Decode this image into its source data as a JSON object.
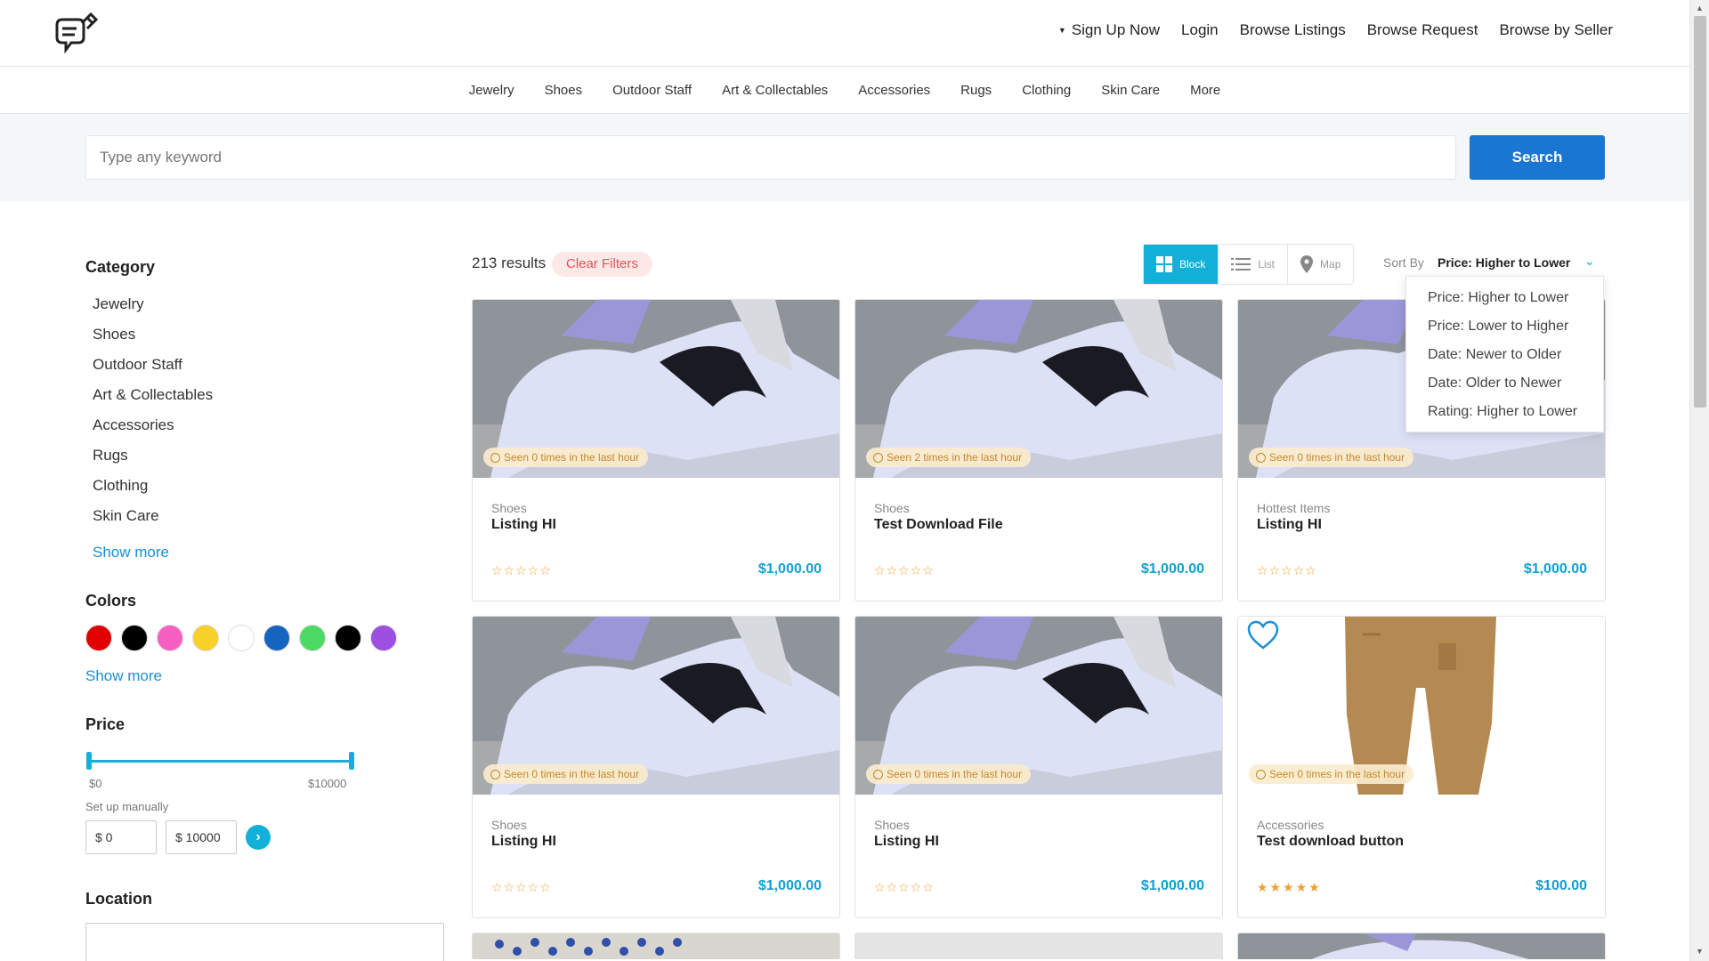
{
  "header": {
    "nav": [
      {
        "label": "Sign Up Now"
      },
      {
        "label": "Login"
      },
      {
        "label": "Browse Listings"
      },
      {
        "label": "Browse Request"
      },
      {
        "label": "Browse by Seller"
      }
    ]
  },
  "categories_bar": [
    "Jewelry",
    "Shoes",
    "Outdoor Staff",
    "Art & Collectables",
    "Accessories",
    "Rugs",
    "Clothing",
    "Skin Care",
    "More"
  ],
  "search": {
    "placeholder": "Type any keyword",
    "button_label": "Search"
  },
  "sidebar": {
    "category_title": "Category",
    "categories": [
      "Jewelry",
      "Shoes",
      "Outdoor Staff",
      "Art & Collectables",
      "Accessories",
      "Rugs",
      "Clothing",
      "Skin Care"
    ],
    "category_show_more": "Show more",
    "colors_title": "Colors",
    "colors": [
      "#e00000",
      "#000000",
      "#f75fc3",
      "#f7d02a",
      "#ffffff",
      "#1565c0",
      "#4cd964",
      "#000000",
      "#9c4fe0"
    ],
    "colors_show_more": "Show more",
    "price_title": "Price",
    "price_min_label": "$0",
    "price_max_label": "$10000",
    "manual_label": "Set up manually",
    "manual_min": "$ 0",
    "manual_max": "$ 10000",
    "go_button": "›",
    "location_title": "Location"
  },
  "results": {
    "count": "213 results",
    "clear_filters": "Clear Filters",
    "views": [
      {
        "label": "Block",
        "icon": "grid-icon",
        "active": true
      },
      {
        "label": "List",
        "icon": "list-icon",
        "active": false
      },
      {
        "label": "Map",
        "icon": "map-pin-icon",
        "active": false
      }
    ],
    "sort_label": "Sort By",
    "sort_value": "Price: Higher to Lower",
    "sort_options": [
      "Price: Higher to Lower",
      "Price: Lower to Higher",
      "Date: Newer to Older",
      "Date: Older to Newer",
      "Rating: Higher to Lower"
    ]
  },
  "listings": [
    {
      "category": "Shoes",
      "title": "Listing HI",
      "price": "$1,000.00",
      "seen": "Seen 0 times in the last hour",
      "stars": "☆☆☆☆☆",
      "image": "shoe"
    },
    {
      "category": "Shoes",
      "title": "Test Download File",
      "price": "$1,000.00",
      "seen": "Seen 2 times in the last hour",
      "stars": "☆☆☆☆☆",
      "image": "shoe"
    },
    {
      "category": "Hottest Items",
      "title": "Listing HI",
      "price": "$1,000.00",
      "seen": "Seen 0 times in the last hour",
      "stars": "☆☆☆☆☆",
      "image": "shoe"
    },
    {
      "category": "Shoes",
      "title": "Listing HI",
      "price": "$1,000.00",
      "seen": "Seen 0 times in the last hour",
      "stars": "☆☆☆☆☆",
      "image": "shoe"
    },
    {
      "category": "Shoes",
      "title": "Listing HI",
      "price": "$1,000.00",
      "seen": "Seen 0 times in the last hour",
      "stars": "☆☆☆☆☆",
      "image": "shoe"
    },
    {
      "category": "Accessories",
      "title": "Test download button",
      "price": "$100.00",
      "seen": "Seen 0 times in the last hour",
      "stars": "★★★★★",
      "image": "pants"
    }
  ],
  "colors": {
    "accent": "#11b0d8",
    "primary_button": "#1976d2",
    "link": "#1a8fd6",
    "price": "#11a0d0",
    "star": "#f0a030"
  }
}
